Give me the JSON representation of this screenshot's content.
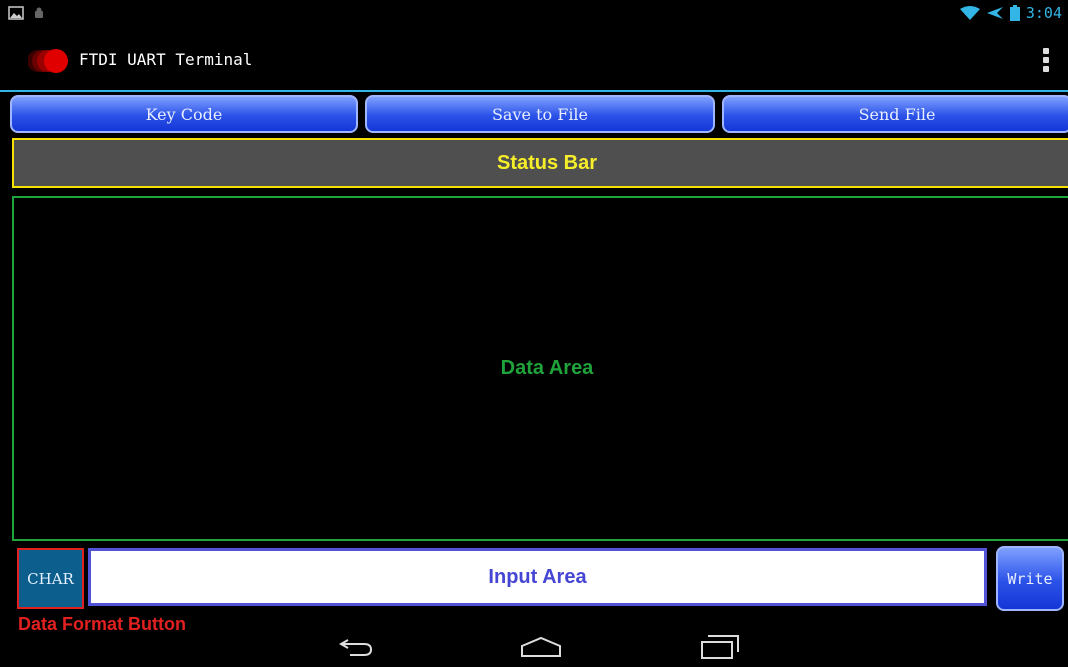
{
  "system": {
    "time": "3:04",
    "icons": [
      "gallery-icon",
      "android-icon",
      "wifi-icon",
      "airplane-mode-icon",
      "battery-icon"
    ]
  },
  "actionbar": {
    "title": "FTDI UART Terminal",
    "overflow_icon": "overflow-menu-icon"
  },
  "toolbar": {
    "key_code": "Key Code",
    "save_to_file": "Save to File",
    "send_file": "Send File"
  },
  "status_area": {
    "label": "Status Bar"
  },
  "data_area": {
    "label": "Data Area"
  },
  "input_row": {
    "format_button": "CHAR",
    "input_label": "Input Area",
    "write_button": "Write",
    "format_button_caption": "Data Format Button"
  },
  "navbar": {
    "icons": [
      "back-icon",
      "home-icon",
      "recent-apps-icon"
    ]
  },
  "colors": {
    "accent": "#33b5e5",
    "button_blue": "#2b52e8",
    "status_yellow": "#f4e300",
    "data_green": "#1fa33a",
    "input_blue": "#4646d4",
    "caption_red": "#e12020"
  }
}
